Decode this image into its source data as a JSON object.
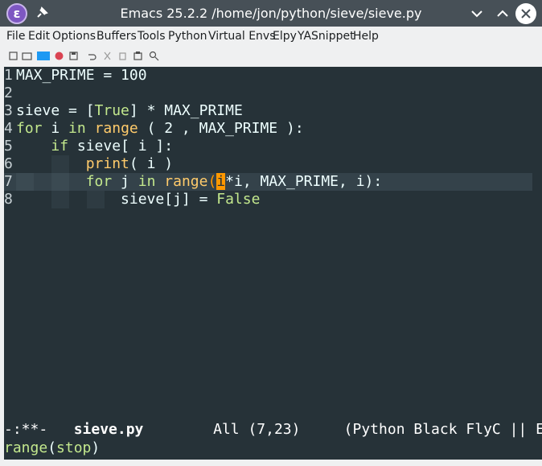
{
  "window": {
    "title": "Emacs 25.2.2 /home/jon/python/sieve/sieve.py"
  },
  "menubar": {
    "items": [
      "File",
      "Edit",
      "Options",
      "Buffers",
      "Tools",
      "Python",
      "Virtual Envs",
      "Elpy",
      "YASnippet",
      "Help"
    ]
  },
  "toolbar": {
    "icons": [
      "new-file-icon",
      "open-folder-icon",
      "dired-icon",
      "close-buffer-icon",
      "save-icon",
      "undo-icon",
      "cut-icon",
      "copy-icon",
      "paste-icon",
      "search-icon"
    ]
  },
  "editor": {
    "lines": [
      {
        "num": "1",
        "code": "MAX_PRIME = 100"
      },
      {
        "num": "2",
        "code": ""
      },
      {
        "num": "3",
        "code": "sieve = [True] * MAX_PRIME"
      },
      {
        "num": "4",
        "code": "for i in range ( 2 , MAX_PRIME ):"
      },
      {
        "num": "5",
        "code": "    if sieve[ i ]:"
      },
      {
        "num": "6",
        "code": "        print( i )"
      },
      {
        "num": "7",
        "code": "        for j in range(i*i, MAX_PRIME, i):"
      },
      {
        "num": "8",
        "code": "            sieve[j] = False"
      }
    ]
  },
  "modeline": {
    "status": "-:**-",
    "buffer_name": "sieve.py",
    "position": "All (7,23)",
    "modes": "(Python Black FlyC || E"
  },
  "echo": {
    "func": "range",
    "arg": "stop",
    "open": "(",
    "close": ")"
  },
  "colors": {
    "background": "#263238",
    "keyword": "#c3e88d",
    "function": "#ffcb6b",
    "cursor": "#ff9800"
  }
}
